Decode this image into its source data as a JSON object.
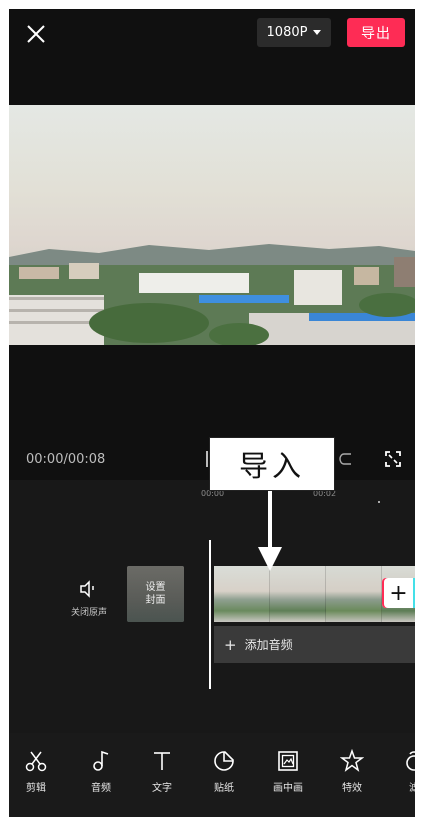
{
  "topbar": {
    "resolution": "1080P",
    "export_label": "导出"
  },
  "preview": {
    "time": "00:00/00:08"
  },
  "annotation": {
    "label": "导入"
  },
  "timeline": {
    "ruler": [
      "00:00",
      "00:02"
    ],
    "mute_label": "关闭原声",
    "cover_line1": "设置",
    "cover_line2": "封面",
    "add_clip_symbol": "+",
    "add_audio_label": "添加音频"
  },
  "toolbar": {
    "items": [
      {
        "label": "剪辑",
        "icon": "scissors-icon"
      },
      {
        "label": "音频",
        "icon": "music-note-icon"
      },
      {
        "label": "文字",
        "icon": "text-icon"
      },
      {
        "label": "贴纸",
        "icon": "sticker-icon"
      },
      {
        "label": "画中画",
        "icon": "picture-in-picture-icon"
      },
      {
        "label": "特效",
        "icon": "effects-star-icon"
      },
      {
        "label": "滤",
        "icon": "filter-icon"
      }
    ]
  }
}
